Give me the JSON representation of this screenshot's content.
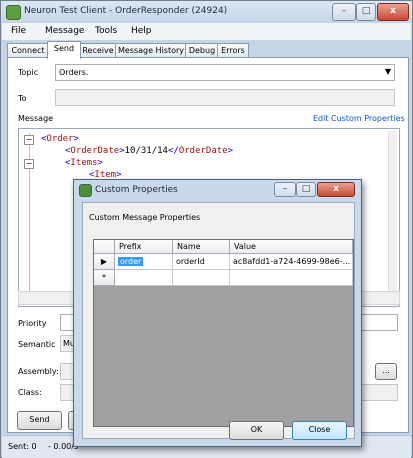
{
  "window": {
    "title": "Neuron Test Client - OrderResponder (24924)",
    "caption_minimize": "–",
    "caption_maximize": "□",
    "caption_close": "x"
  },
  "menu": [
    "File",
    "Message",
    "Tools",
    "Help"
  ],
  "tabs": [
    "Connect",
    "Send",
    "Receive",
    "Message History",
    "Debug",
    "Errors"
  ],
  "active_tab": "Send",
  "send": {
    "topic_label": "Topic",
    "topic_value": "Orders.",
    "to_label": "To",
    "to_value": "",
    "message_label": "Message",
    "edit_custom_link": "Edit Custom Properties",
    "xml_lines": [
      {
        "b1": "<",
        "tag": "Order",
        "b2": ">",
        "text": ""
      },
      {
        "b1": "<",
        "tag": "OrderDate",
        "b2": ">",
        "text": "10/31/14",
        "b3": "</",
        "tag2": "OrderDate",
        "b4": ">"
      },
      {
        "b1": "<",
        "tag": "Items",
        "b2": ">",
        "text": ""
      },
      {
        "b1": "<",
        "tag": "Item",
        "b2": ">",
        "text": ""
      }
    ],
    "collapse_minus": "−",
    "priority_label": "Priority",
    "semantic_label": "Semantic",
    "semantic_value": "Mu",
    "assembly_label": "Assembly:",
    "browse_button": "...",
    "class_label": "Class:",
    "send_button": "Send"
  },
  "status": {
    "sent": "Sent: 0",
    "rate": "- 0.00/s"
  },
  "dialog": {
    "title": "Custom Properties",
    "heading": "Custom Message Properties",
    "columns": [
      "Prefix",
      "Name",
      "Value"
    ],
    "rows": [
      {
        "marker": "▶",
        "prefix": "order",
        "name": "orderId",
        "value": "ac8afdd1-a724-4699-98e6-..."
      },
      {
        "marker": "*",
        "prefix": "",
        "name": "",
        "value": ""
      }
    ],
    "ok_button": "OK",
    "close_button": "Close"
  },
  "colors": {
    "xml_tag": "#a31515",
    "xml_bracket": "#0000ff",
    "link": "#0a58c6",
    "title_bg": "#c4d4e7"
  }
}
